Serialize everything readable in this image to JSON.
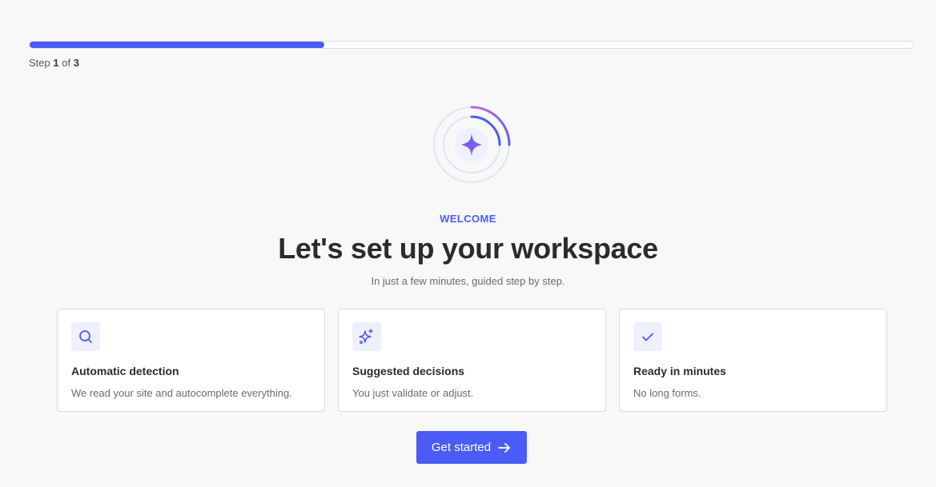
{
  "progress": {
    "fraction": 0.333,
    "step_word": "Step",
    "current": "1",
    "of_word": "of",
    "total": "3"
  },
  "hero": {
    "icon": "sparkle-icon",
    "eyebrow": "WELCOME",
    "title": "Let's set up your workspace",
    "subtitle": "In just a few minutes, guided step by step."
  },
  "cards": [
    {
      "icon": "search-icon",
      "title": "Automatic detection",
      "desc": "We read your site and autocomplete everything."
    },
    {
      "icon": "sparkles-icon",
      "title": "Suggested decisions",
      "desc": "You just validate or adjust."
    },
    {
      "icon": "check-icon",
      "title": "Ready in minutes",
      "desc": "No long forms."
    }
  ],
  "cta": {
    "label": "Get started",
    "icon": "arrow-right-icon"
  },
  "colors": {
    "accent": "#4a5cf5",
    "hero_gradient_start": "#7b5cf0",
    "hero_gradient_end": "#c06adf"
  }
}
